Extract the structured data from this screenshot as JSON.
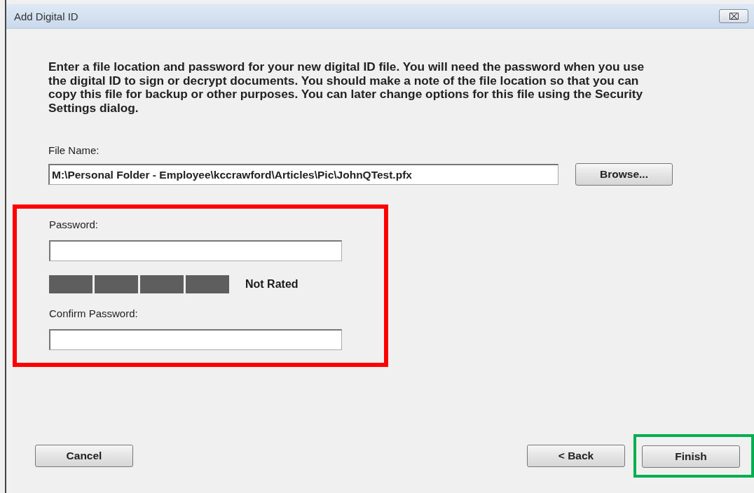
{
  "window": {
    "title": "Add Digital ID",
    "close_label": "⌧"
  },
  "description": "Enter a file location and password for your new digital ID file. You will need the password when you use the digital ID to sign or decrypt documents. You should make a note of the file location so that you can copy this file for backup or other purposes. You can later change options for this file using the Security Settings dialog.",
  "file_name": {
    "label": "File Name:",
    "value": "M:\\Personal Folder - Employee\\kccrawford\\Articles\\Pic\\JohnQTest.pfx",
    "button": "Browse..."
  },
  "password_section": {
    "highlighted": true,
    "password": {
      "label": "Password:"
    },
    "strength": {
      "rating": "Not Rated"
    },
    "confirm": {
      "label": "Confirm Password:"
    }
  },
  "buttons": [
    {
      "label": "Cancel",
      "highlighted": false
    },
    {
      "label": "< Back",
      "highlighted": false
    },
    {
      "label": "Finish",
      "highlighted": true
    }
  ]
}
